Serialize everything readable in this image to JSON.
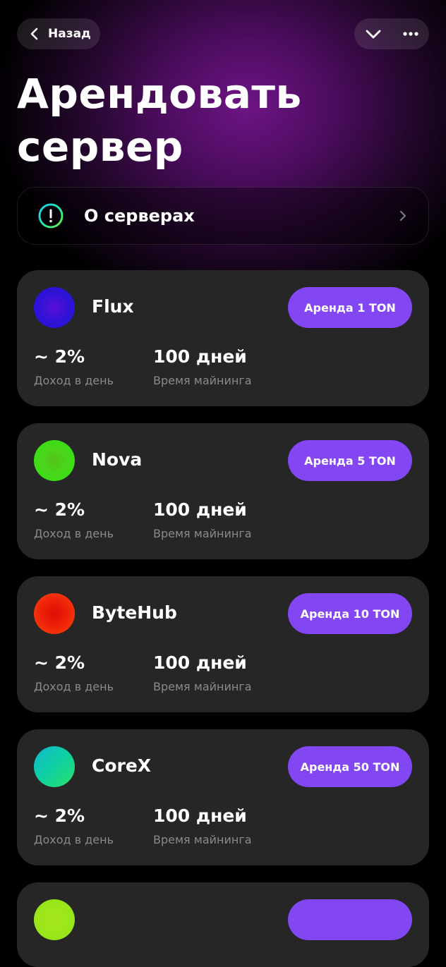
{
  "header": {
    "back_label": "Назад",
    "title_line1": "Арендовать",
    "title_line2": "сервер",
    "icons": [
      "chevron-left-icon",
      "chevron-down-icon",
      "more-horizontal-icon"
    ]
  },
  "info": {
    "label": "О серверах",
    "icon": "alert-circle-icon",
    "arrow_icon": "chevron-right-icon"
  },
  "colors": {
    "accent": "#8346f3",
    "card_bg": "#262626",
    "muted_text": "#8a8a8a",
    "glow": "#6e1486"
  },
  "servers": [
    {
      "name": "Flux",
      "rent_label": "Аренда 1 TON",
      "income_value": "~ 2%",
      "income_label": "Доход в день",
      "time_value": "100 дней",
      "time_label": "Время майнинга",
      "color_inner": "#5a10d8",
      "color_outer": "#1c16d6"
    },
    {
      "name": "Nova",
      "rent_label": "Аренда 5 TON",
      "income_value": "~ 2%",
      "income_label": "Доход в день",
      "time_value": "100 дней",
      "time_label": "Время майнинга",
      "color_inner": "#55c21a",
      "color_outer": "#2ee612"
    },
    {
      "name": "ByteHub",
      "rent_label": "Аренда 10 TON",
      "income_value": "~ 2%",
      "income_label": "Доход в день",
      "time_value": "100 дней",
      "time_label": "Время майнинга",
      "color_inner": "#e00c06",
      "color_outer": "#ff4a10"
    },
    {
      "name": "CoreX",
      "rent_label": "Аренда 50 TON",
      "income_value": "~ 2%",
      "income_label": "Доход в день",
      "time_value": "100 дней",
      "time_label": "Время майнинга",
      "color_inner": "#0fd0a0",
      "color_outer": "#2ae06a"
    }
  ],
  "partial_server": {
    "color": "#8ee61a"
  }
}
